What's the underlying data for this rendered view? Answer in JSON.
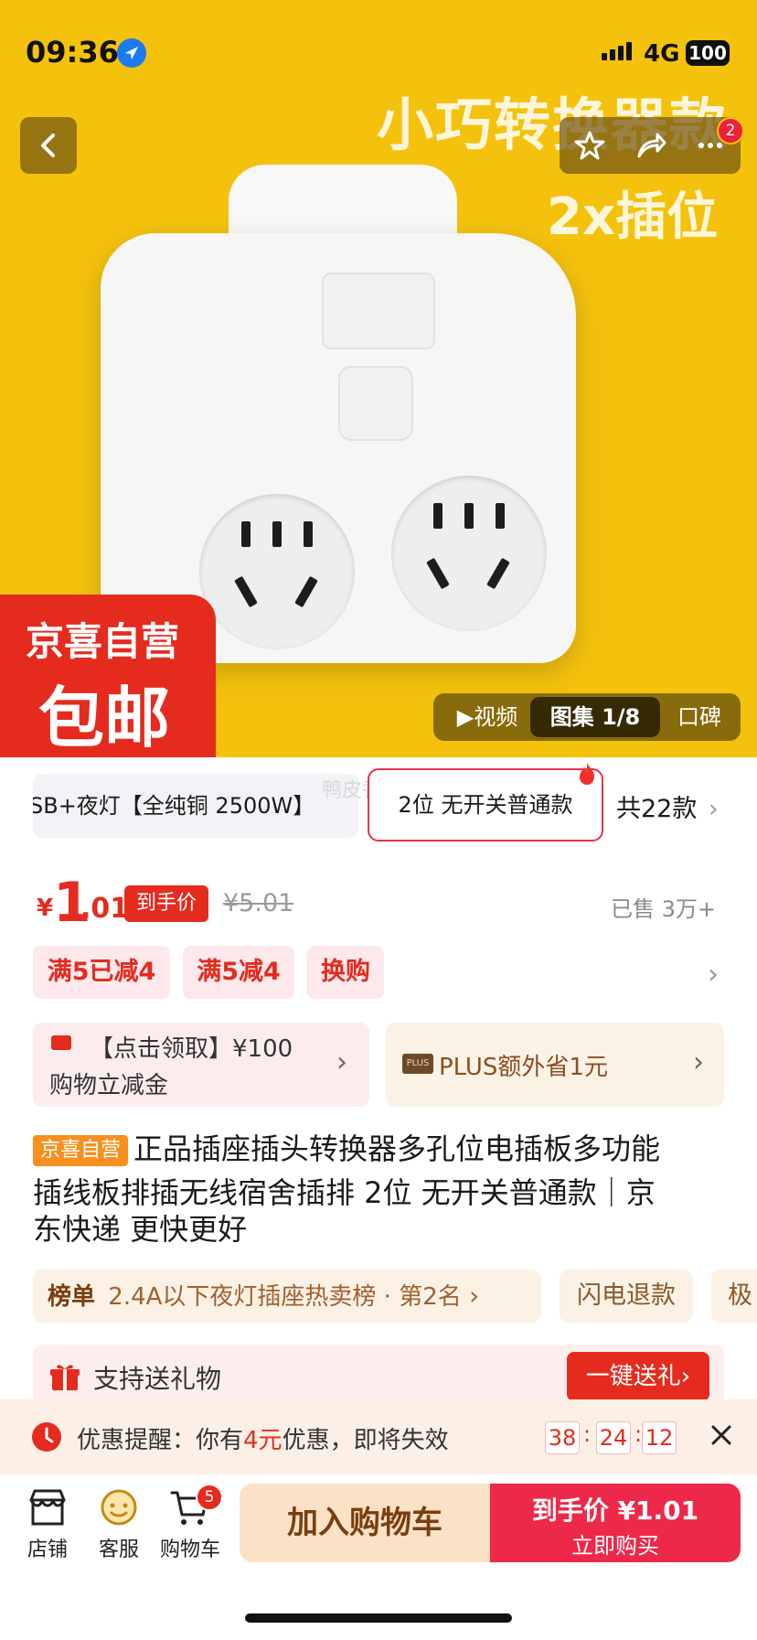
{
  "status_bar": {
    "time": "09:36",
    "network": "4G",
    "battery": "100"
  },
  "nav": {
    "badge_count": "2"
  },
  "hero": {
    "promo_line1": "小巧转换器款",
    "promo_line2": "2x插位",
    "jd_logo_line1": "京喜自营",
    "jd_logo_line2": "包邮",
    "media_tabs": [
      {
        "label": "▶视频"
      },
      {
        "label": "图集 1/8"
      },
      {
        "label": "口碑"
      }
    ]
  },
  "variants": {
    "option1": "SB+夜灯【全纯铜 2500W】",
    "option2": "2位 无开关普通款",
    "total": "共22款",
    "watermark": "鸭皮香"
  },
  "price": {
    "currency": "¥",
    "integer": "1",
    "decimal": ".01",
    "tag": "到手价",
    "original": "¥5.01",
    "sold": "已售 3万+"
  },
  "coupons": [
    "满5已减4",
    "满5减4",
    "换购"
  ],
  "cards": {
    "claim_line1": "【点击领取】¥100",
    "claim_line2": "购物立减金",
    "plus_badge": "PLUS",
    "plus_text": "PLUS额外省1元"
  },
  "title": {
    "tag": "京喜自营",
    "line1": "正品插座插头转换器多孔位电插板多功能",
    "line2": "插线板排插无线宿舍插排 2位 无开关普通款｜京",
    "line3": "东快递 更快更好"
  },
  "rank": {
    "label": "榜单",
    "text": "2.4A以下夜灯插座热卖榜 · 第2名",
    "chip1": "闪电退款",
    "chip2": "极"
  },
  "gift": {
    "text": "支持送礼物",
    "button": "一键送礼"
  },
  "reminder": {
    "prefix": "优惠提醒：你有",
    "amount": "4元",
    "suffix": "优惠，即将失效",
    "hours": "38",
    "minutes": "24",
    "seconds": "12",
    "sep": ":"
  },
  "bottom_bar": {
    "store": "店铺",
    "service": "客服",
    "cart": "购物车",
    "cart_badge": "5",
    "add_to_cart": "加入购物车",
    "buy_price_label": "到手价 ¥1.01",
    "buy_now": "立即购买"
  },
  "colors": {
    "accent": "#e52b1e",
    "hero_bg": "#f4c20d",
    "buy": "#ee2849"
  }
}
